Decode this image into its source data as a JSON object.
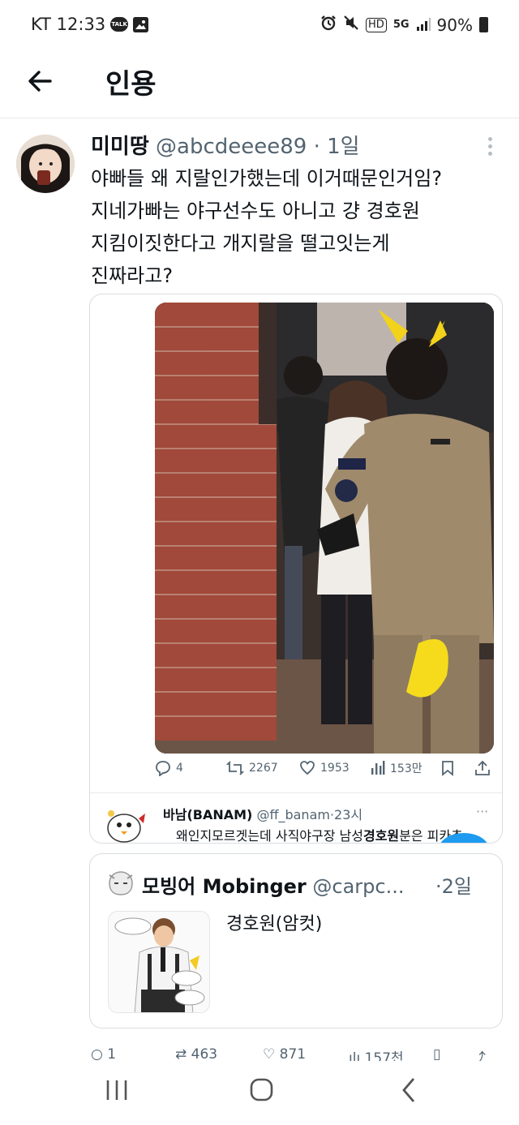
{
  "status_bar": {
    "carrier_time": "KT 12:33",
    "talk_icon_text": "TALK",
    "hd_label": "HD",
    "network_label": "5G",
    "battery_percent": "90%",
    "icons": [
      "talk-icon",
      "gallery-icon",
      "alarm-icon",
      "mute-icon",
      "hd-icon",
      "5g-icon",
      "signal-icon",
      "battery-icon"
    ]
  },
  "header": {
    "title": "인용"
  },
  "tweet": {
    "name": "미미땅",
    "handle": "@abcdeeee89",
    "separator": " · ",
    "time": "1일",
    "lines": [
      "야빠들 왜 지랄인가했는데 이거때문인거임?",
      "지네가빠는 야구선수도 아니고 걍 경호원",
      "지킴이짓한다고 개지랄을 떨고잇는게",
      "진짜라고?"
    ]
  },
  "quote_card": {
    "photo_kind": "photo of security guard with pikachu ears and tail",
    "stats": {
      "replies": "4",
      "retweets": "2267",
      "likes": "1953",
      "views": "153만"
    },
    "reply": {
      "name": "바남(BANAM)",
      "handle": "@ff_banam",
      "separator": "·",
      "time": "23시",
      "more": "···",
      "text_before": "왜인지모르겟는데 사직야구장 남성",
      "text_bold": "경호원",
      "text_after": "분은 피카츄"
    }
  },
  "quote2": {
    "name": "모빙어 Mobinger",
    "handle": "@carpc...",
    "separator": "·",
    "time": "2일",
    "text": "경호원(암컷)"
  },
  "bottom_stats": {
    "replies": "1",
    "retweets": "463",
    "likes": "871",
    "views": "157천"
  },
  "colors": {
    "text": "#0f1419",
    "secondary": "#536471",
    "border": "#d9dde1",
    "accent_blue": "#1d9bf0"
  }
}
